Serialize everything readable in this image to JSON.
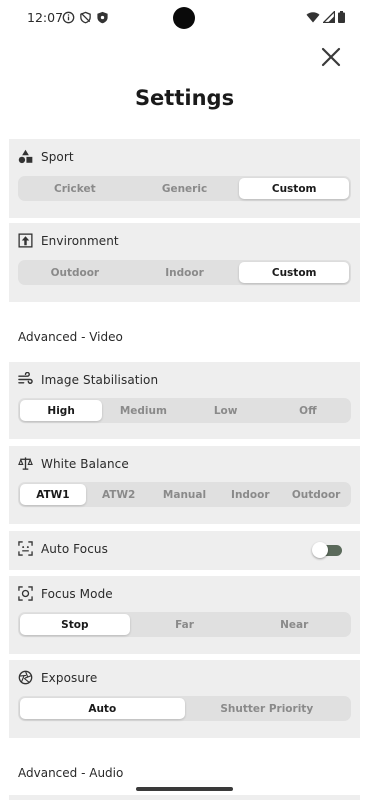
{
  "status_bar": {
    "time": "12:07",
    "left_icons": [
      "info-icon",
      "no-disturb-icon",
      "shield-icon"
    ],
    "right_icons": [
      "wifi-icon",
      "signal-icon",
      "battery-icon"
    ]
  },
  "header": {
    "title": "Settings",
    "close_icon": "close-icon"
  },
  "sport": {
    "label": "Sport",
    "options": [
      "Cricket",
      "Generic",
      "Custom"
    ],
    "selected": "Custom"
  },
  "environment": {
    "label": "Environment",
    "options": [
      "Outdoor",
      "Indoor",
      "Custom"
    ],
    "selected": "Custom"
  },
  "advanced_video": {
    "label": "Advanced - Video"
  },
  "image_stabilisation": {
    "label": "Image Stabilisation",
    "options": [
      "High",
      "Medium",
      "Low",
      "Off"
    ],
    "selected": "High"
  },
  "white_balance": {
    "label": "White Balance",
    "options": [
      "ATW1",
      "ATW2",
      "Manual",
      "Indoor",
      "Outdoor"
    ],
    "selected": "ATW1"
  },
  "auto_focus": {
    "label": "Auto Focus",
    "enabled": false
  },
  "focus_mode": {
    "label": "Focus Mode",
    "options": [
      "Stop",
      "Far",
      "Near"
    ],
    "selected": "Stop"
  },
  "exposure": {
    "label": "Exposure",
    "options": [
      "Auto",
      "Shutter Priority"
    ],
    "selected": "Auto"
  },
  "advanced_audio": {
    "label": "Advanced - Audio"
  },
  "colors": {
    "card_bg": "#eeeeee",
    "segment_bg": "#e0e0e0",
    "segment_active": "#ffffff",
    "toggle_track": "#5b6a5b"
  }
}
